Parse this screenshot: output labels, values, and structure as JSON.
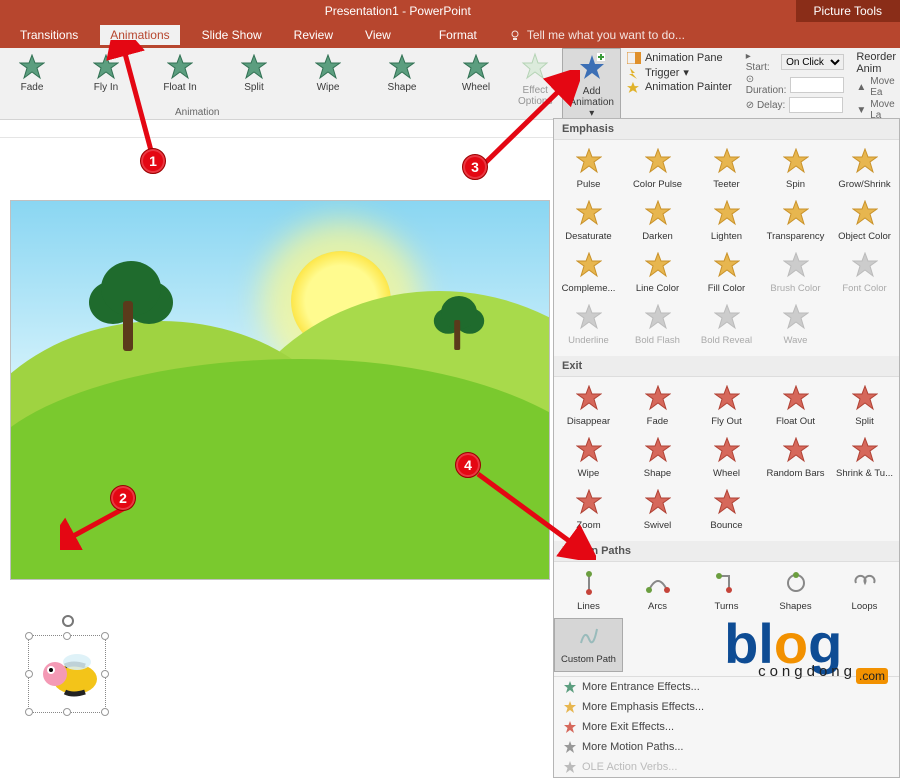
{
  "titlebar": {
    "title": "Presentation1 - PowerPoint",
    "context_tab": "Picture Tools"
  },
  "menubar": {
    "tabs": [
      "Transitions",
      "Animations",
      "Slide Show",
      "Review",
      "View",
      "Format"
    ],
    "active_index": 1,
    "tell_me": "Tell me what you want to do..."
  },
  "ribbon": {
    "gallery": [
      "Fade",
      "Fly In",
      "Float In",
      "Split",
      "Wipe",
      "Shape",
      "Wheel"
    ],
    "gallery_group": "Animation",
    "effect_options": "Effect\nOptions",
    "add_animation": "Add\nAnimation",
    "advanced": {
      "pane": "Animation Pane",
      "trigger": "Trigger",
      "painter": "Animation Painter"
    },
    "timing": {
      "start_lbl": "Start:",
      "start_val": "On Click",
      "duration_lbl": "Duration:",
      "duration_val": "",
      "delay_lbl": "Delay:",
      "delay_val": ""
    },
    "reorder": {
      "title": "Reorder Anim",
      "earlier": "Move Ea",
      "later": "Move La"
    }
  },
  "dropdown": {
    "sections": {
      "emphasis": {
        "title": "Emphasis",
        "items": [
          "Pulse",
          "Color Pulse",
          "Teeter",
          "Spin",
          "Grow/Shrink",
          "Desaturate",
          "Darken",
          "Lighten",
          "Transparency",
          "Object Color",
          "Compleme...",
          "Line Color",
          "Fill Color",
          "Brush Color",
          "Font Color",
          "Underline",
          "Bold Flash",
          "Bold Reveal",
          "Wave"
        ],
        "disabled": [
          13,
          14,
          15,
          16,
          17,
          18
        ]
      },
      "exit": {
        "title": "Exit",
        "items": [
          "Disappear",
          "Fade",
          "Fly Out",
          "Float Out",
          "Split",
          "Wipe",
          "Shape",
          "Wheel",
          "Random Bars",
          "Shrink & Tu...",
          "Zoom",
          "Swivel",
          "Bounce"
        ]
      },
      "motion": {
        "title": "Motion Paths",
        "items": [
          "Lines",
          "Arcs",
          "Turns",
          "Shapes",
          "Loops",
          "Custom Path"
        ],
        "selected": 5
      }
    },
    "footer": [
      "More Entrance Effects...",
      "More Emphasis Effects...",
      "More Exit Effects...",
      "More Motion Paths...",
      "OLE Action Verbs..."
    ]
  },
  "markers": {
    "1": "1",
    "2": "2",
    "3": "3",
    "4": "4"
  },
  "watermark": {
    "main": "blog",
    "sub": "congdong",
    "tld": ".com"
  }
}
